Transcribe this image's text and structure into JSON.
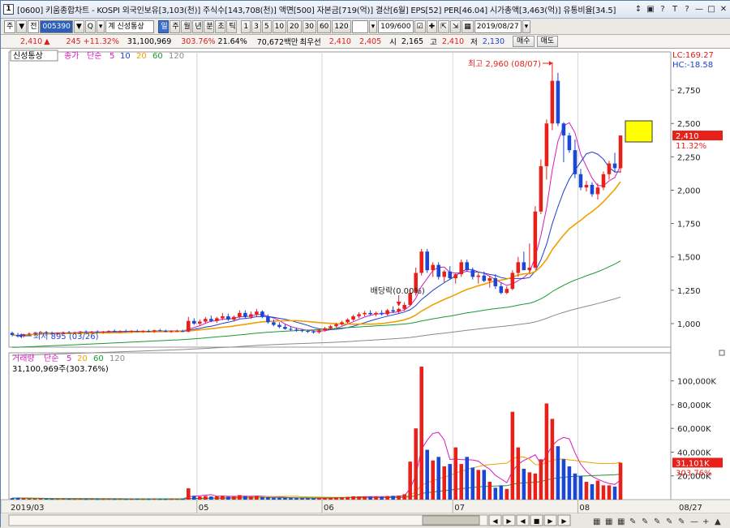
{
  "title": {
    "icon_label": "1",
    "text": "[0600] 키움종합차트 - KOSPI 외국인보유[3,103(천)] 주식수[143,708(천)] 액면[500] 자본금[719(억)] 결산[6월] EPS[52] PER[46.04] 시가총액[3,463(억)] 유통비율[34.5]",
    "buttons": [
      "↕",
      "▣",
      "?",
      "T",
      "?",
      "—",
      "□",
      "✕"
    ]
  },
  "toolbar": {
    "period_type": "주",
    "market": "전",
    "code": "005390",
    "name": "계 신성통상",
    "timeframes": [
      "일",
      "주",
      "월",
      "년",
      "분",
      "초",
      "틱"
    ],
    "timeframe_selected": "일",
    "minute_options": [
      "1",
      "3",
      "5",
      "10",
      "20",
      "30",
      "60",
      "120"
    ],
    "count": "109/600",
    "date": "2019/08/27"
  },
  "quote": {
    "price": "2,410",
    "arrow": "▲",
    "change": "245",
    "change_pct": "+11.32%",
    "volume": "31,100,969",
    "vol_ratio": "303.76%",
    "turnover": "21.64%",
    "amount": "70,672백만",
    "best_label": "최우선",
    "best_ask": "2,410",
    "best_bid": "2,405",
    "open_label": "시",
    "open": "2,165",
    "high_label": "고",
    "high": "2,410",
    "low_label": "저",
    "low": "2,130",
    "buy_label": "매수",
    "sell_label": "매도"
  },
  "colors": {
    "up": "#e8201a",
    "down": "#1a47d6",
    "ma5": "#d81bbd",
    "ma10": "#1a3fd0",
    "ma20": "#f0a000",
    "ma60": "#1a9a30",
    "ma120": "#8a8a8a",
    "lc": "#e01a1a",
    "hc": "#1a3fd0"
  },
  "price_panel": {
    "name": "신성통상",
    "legend": [
      {
        "label": "종가",
        "color_key": "ma5"
      },
      {
        "label": "단순",
        "color_key": "ma5"
      },
      {
        "label": "5",
        "color_key": "ma5"
      },
      {
        "label": "10",
        "color_key": "ma10"
      },
      {
        "label": "20",
        "color_key": "ma20"
      },
      {
        "label": "60",
        "color_key": "ma60"
      },
      {
        "label": "120",
        "color_key": "ma120"
      }
    ],
    "lc_text": "LC:169.27",
    "hc_text": "HC:-18.58",
    "high_note": "최고 2,960 (08/07)",
    "low_note": "최저 895 (03/26)",
    "div_note": "배당락(0.00%)",
    "last_price": "2,410",
    "last_pct": "11.32%"
  },
  "volume_panel": {
    "legend": [
      {
        "label": "거래량",
        "color_key": "ma5"
      },
      {
        "label": "단순",
        "color_key": "ma5"
      },
      {
        "label": "5",
        "color_key": "ma5"
      },
      {
        "label": "20",
        "color_key": "ma20"
      },
      {
        "label": "60",
        "color_key": "ma60"
      },
      {
        "label": "120",
        "color_key": "ma120"
      }
    ],
    "vol_text": "31,100,969주(303.76%)",
    "last_vol": "31,101K",
    "last_pct": "303.76%"
  },
  "x_axis_labels": [
    "2019/03",
    "05",
    "06",
    "07",
    "08",
    "08/27"
  ],
  "y_axis_price_ticks": [
    "2,750",
    "2,500",
    "2,250",
    "2,000",
    "1,750",
    "1,500",
    "1,250",
    "1,000"
  ],
  "y_axis_vol_ticks": [
    "100,000K",
    "80,000K",
    "60,000K",
    "40,000K",
    "20,000K"
  ],
  "chart_data": {
    "type": "candlestick",
    "price_range": [
      860,
      3000
    ],
    "volume_range": [
      0,
      110000
    ],
    "candles": [
      {
        "o": 930,
        "h": 940,
        "l": 905,
        "c": 915,
        "v": 1200
      },
      {
        "o": 915,
        "h": 930,
        "l": 895,
        "c": 905,
        "v": 1500
      },
      {
        "o": 905,
        "h": 925,
        "l": 895,
        "c": 920,
        "v": 1100
      },
      {
        "o": 920,
        "h": 935,
        "l": 910,
        "c": 925,
        "v": 900
      },
      {
        "o": 925,
        "h": 940,
        "l": 915,
        "c": 930,
        "v": 800
      },
      {
        "o": 930,
        "h": 945,
        "l": 920,
        "c": 935,
        "v": 900
      },
      {
        "o": 935,
        "h": 945,
        "l": 925,
        "c": 930,
        "v": 700
      },
      {
        "o": 930,
        "h": 940,
        "l": 920,
        "c": 925,
        "v": 600
      },
      {
        "o": 925,
        "h": 935,
        "l": 915,
        "c": 930,
        "v": 600
      },
      {
        "o": 930,
        "h": 940,
        "l": 920,
        "c": 935,
        "v": 700
      },
      {
        "o": 935,
        "h": 945,
        "l": 925,
        "c": 930,
        "v": 600
      },
      {
        "o": 930,
        "h": 940,
        "l": 920,
        "c": 935,
        "v": 500
      },
      {
        "o": 935,
        "h": 945,
        "l": 925,
        "c": 940,
        "v": 600
      },
      {
        "o": 940,
        "h": 950,
        "l": 930,
        "c": 935,
        "v": 500
      },
      {
        "o": 935,
        "h": 945,
        "l": 925,
        "c": 940,
        "v": 600
      },
      {
        "o": 940,
        "h": 950,
        "l": 930,
        "c": 935,
        "v": 500
      },
      {
        "o": 935,
        "h": 945,
        "l": 925,
        "c": 940,
        "v": 500
      },
      {
        "o": 940,
        "h": 950,
        "l": 930,
        "c": 945,
        "v": 600
      },
      {
        "o": 945,
        "h": 955,
        "l": 935,
        "c": 940,
        "v": 500
      },
      {
        "o": 940,
        "h": 950,
        "l": 930,
        "c": 945,
        "v": 600
      },
      {
        "o": 945,
        "h": 955,
        "l": 935,
        "c": 940,
        "v": 500
      },
      {
        "o": 940,
        "h": 950,
        "l": 930,
        "c": 945,
        "v": 500
      },
      {
        "o": 945,
        "h": 955,
        "l": 935,
        "c": 940,
        "v": 600
      },
      {
        "o": 940,
        "h": 950,
        "l": 930,
        "c": 945,
        "v": 500
      },
      {
        "o": 945,
        "h": 955,
        "l": 935,
        "c": 940,
        "v": 500
      },
      {
        "o": 940,
        "h": 955,
        "l": 930,
        "c": 950,
        "v": 600
      },
      {
        "o": 950,
        "h": 960,
        "l": 940,
        "c": 945,
        "v": 500
      },
      {
        "o": 945,
        "h": 955,
        "l": 935,
        "c": 940,
        "v": 500
      },
      {
        "o": 940,
        "h": 950,
        "l": 930,
        "c": 945,
        "v": 500
      },
      {
        "o": 945,
        "h": 955,
        "l": 935,
        "c": 945,
        "v": 600
      },
      {
        "o": 945,
        "h": 955,
        "l": 935,
        "c": 940,
        "v": 500
      },
      {
        "o": 940,
        "h": 1050,
        "l": 935,
        "c": 1020,
        "v": 9500
      },
      {
        "o": 1020,
        "h": 1040,
        "l": 990,
        "c": 1000,
        "v": 3200
      },
      {
        "o": 1000,
        "h": 1030,
        "l": 985,
        "c": 1015,
        "v": 2600
      },
      {
        "o": 1015,
        "h": 1050,
        "l": 1005,
        "c": 1035,
        "v": 3000
      },
      {
        "o": 1035,
        "h": 1060,
        "l": 1010,
        "c": 1020,
        "v": 2600
      },
      {
        "o": 1020,
        "h": 1050,
        "l": 1005,
        "c": 1040,
        "v": 2800
      },
      {
        "o": 1040,
        "h": 1080,
        "l": 1025,
        "c": 1055,
        "v": 3300
      },
      {
        "o": 1055,
        "h": 1075,
        "l": 1020,
        "c": 1030,
        "v": 2400
      },
      {
        "o": 1030,
        "h": 1060,
        "l": 1015,
        "c": 1050,
        "v": 2500
      },
      {
        "o": 1050,
        "h": 1100,
        "l": 1040,
        "c": 1080,
        "v": 3800
      },
      {
        "o": 1080,
        "h": 1100,
        "l": 1040,
        "c": 1050,
        "v": 2800
      },
      {
        "o": 1050,
        "h": 1090,
        "l": 1035,
        "c": 1070,
        "v": 2600
      },
      {
        "o": 1070,
        "h": 1110,
        "l": 1050,
        "c": 1090,
        "v": 3200
      },
      {
        "o": 1090,
        "h": 1100,
        "l": 1040,
        "c": 1050,
        "v": 2200
      },
      {
        "o": 1050,
        "h": 1070,
        "l": 1000,
        "c": 1010,
        "v": 2100
      },
      {
        "o": 1010,
        "h": 1030,
        "l": 980,
        "c": 990,
        "v": 1800
      },
      {
        "o": 990,
        "h": 1010,
        "l": 965,
        "c": 975,
        "v": 1600
      },
      {
        "o": 975,
        "h": 995,
        "l": 955,
        "c": 960,
        "v": 1400
      },
      {
        "o": 960,
        "h": 980,
        "l": 945,
        "c": 955,
        "v": 1300
      },
      {
        "o": 955,
        "h": 970,
        "l": 940,
        "c": 950,
        "v": 1200
      },
      {
        "o": 950,
        "h": 960,
        "l": 935,
        "c": 945,
        "v": 1100
      },
      {
        "o": 945,
        "h": 955,
        "l": 930,
        "c": 940,
        "v": 1000
      },
      {
        "o": 940,
        "h": 950,
        "l": 925,
        "c": 935,
        "v": 1000
      },
      {
        "o": 935,
        "h": 960,
        "l": 925,
        "c": 950,
        "v": 1200
      },
      {
        "o": 950,
        "h": 975,
        "l": 940,
        "c": 965,
        "v": 1400
      },
      {
        "o": 965,
        "h": 990,
        "l": 955,
        "c": 980,
        "v": 1600
      },
      {
        "o": 980,
        "h": 1005,
        "l": 970,
        "c": 995,
        "v": 1800
      },
      {
        "o": 995,
        "h": 1020,
        "l": 985,
        "c": 1010,
        "v": 2000
      },
      {
        "o": 1010,
        "h": 1040,
        "l": 1000,
        "c": 1030,
        "v": 2300
      },
      {
        "o": 1030,
        "h": 1065,
        "l": 1020,
        "c": 1055,
        "v": 2800
      },
      {
        "o": 1055,
        "h": 1085,
        "l": 1040,
        "c": 1070,
        "v": 2700
      },
      {
        "o": 1070,
        "h": 1095,
        "l": 1055,
        "c": 1080,
        "v": 2600
      },
      {
        "o": 1080,
        "h": 1100,
        "l": 1060,
        "c": 1070,
        "v": 2400
      },
      {
        "o": 1070,
        "h": 1090,
        "l": 1055,
        "c": 1080,
        "v": 2500
      },
      {
        "o": 1080,
        "h": 1100,
        "l": 1060,
        "c": 1070,
        "v": 2300
      },
      {
        "o": 1070,
        "h": 1110,
        "l": 1060,
        "c": 1100,
        "v": 3000
      },
      {
        "o": 1100,
        "h": 1130,
        "l": 1080,
        "c": 1090,
        "v": 3200
      },
      {
        "o": 1090,
        "h": 1120,
        "l": 1075,
        "c": 1110,
        "v": 3400
      },
      {
        "o": 1110,
        "h": 1160,
        "l": 1095,
        "c": 1140,
        "v": 4500
      },
      {
        "o": 1140,
        "h": 1260,
        "l": 1130,
        "c": 1230,
        "v": 32000
      },
      {
        "o": 1230,
        "h": 1420,
        "l": 1210,
        "c": 1380,
        "v": 60000
      },
      {
        "o": 1380,
        "h": 1560,
        "l": 1360,
        "c": 1540,
        "v": 112000
      },
      {
        "o": 1540,
        "h": 1560,
        "l": 1380,
        "c": 1400,
        "v": 42000
      },
      {
        "o": 1400,
        "h": 1460,
        "l": 1350,
        "c": 1440,
        "v": 33000
      },
      {
        "o": 1440,
        "h": 1460,
        "l": 1330,
        "c": 1350,
        "v": 36000
      },
      {
        "o": 1350,
        "h": 1400,
        "l": 1310,
        "c": 1390,
        "v": 28000
      },
      {
        "o": 1390,
        "h": 1430,
        "l": 1330,
        "c": 1340,
        "v": 30000
      },
      {
        "o": 1340,
        "h": 1380,
        "l": 1300,
        "c": 1370,
        "v": 44000
      },
      {
        "o": 1370,
        "h": 1480,
        "l": 1350,
        "c": 1460,
        "v": 30000
      },
      {
        "o": 1460,
        "h": 1480,
        "l": 1390,
        "c": 1400,
        "v": 36000
      },
      {
        "o": 1400,
        "h": 1420,
        "l": 1330,
        "c": 1350,
        "v": 27000
      },
      {
        "o": 1350,
        "h": 1380,
        "l": 1300,
        "c": 1360,
        "v": 25000
      },
      {
        "o": 1360,
        "h": 1390,
        "l": 1310,
        "c": 1320,
        "v": 25000
      },
      {
        "o": 1320,
        "h": 1360,
        "l": 1270,
        "c": 1340,
        "v": 15000
      },
      {
        "o": 1340,
        "h": 1370,
        "l": 1260,
        "c": 1280,
        "v": 10000
      },
      {
        "o": 1280,
        "h": 1310,
        "l": 1220,
        "c": 1230,
        "v": 12000
      },
      {
        "o": 1230,
        "h": 1280,
        "l": 1220,
        "c": 1260,
        "v": 9000
      },
      {
        "o": 1260,
        "h": 1400,
        "l": 1250,
        "c": 1380,
        "v": 74000
      },
      {
        "o": 1380,
        "h": 1500,
        "l": 1350,
        "c": 1460,
        "v": 44000
      },
      {
        "o": 1460,
        "h": 1540,
        "l": 1420,
        "c": 1400,
        "v": 26000
      },
      {
        "o": 1400,
        "h": 1600,
        "l": 1380,
        "c": 1420,
        "v": 23000
      },
      {
        "o": 1420,
        "h": 1880,
        "l": 1410,
        "c": 1840,
        "v": 22000
      },
      {
        "o": 1840,
        "h": 2230,
        "l": 1820,
        "c": 2180,
        "v": 34000
      },
      {
        "o": 2180,
        "h": 2530,
        "l": 2080,
        "c": 2500,
        "v": 81000
      },
      {
        "o": 2500,
        "h": 2960,
        "l": 2450,
        "c": 2820,
        "v": 68000
      },
      {
        "o": 2820,
        "h": 2880,
        "l": 2480,
        "c": 2500,
        "v": 45000
      },
      {
        "o": 2500,
        "h": 2510,
        "l": 2210,
        "c": 2410,
        "v": 34000
      },
      {
        "o": 2410,
        "h": 2430,
        "l": 2280,
        "c": 2300,
        "v": 28000
      },
      {
        "o": 2300,
        "h": 2380,
        "l": 2090,
        "c": 2120,
        "v": 22000
      },
      {
        "o": 2120,
        "h": 2160,
        "l": 2000,
        "c": 2020,
        "v": 20000
      },
      {
        "o": 2020,
        "h": 2070,
        "l": 1990,
        "c": 2040,
        "v": 15000
      },
      {
        "o": 2040,
        "h": 2060,
        "l": 1950,
        "c": 1970,
        "v": 13000
      },
      {
        "o": 1970,
        "h": 2050,
        "l": 1930,
        "c": 2020,
        "v": 16000
      },
      {
        "o": 2020,
        "h": 2140,
        "l": 2000,
        "c": 2120,
        "v": 12000
      },
      {
        "o": 2120,
        "h": 2220,
        "l": 2080,
        "c": 2200,
        "v": 12000
      },
      {
        "o": 2200,
        "h": 2280,
        "l": 2130,
        "c": 2165,
        "v": 11000
      },
      {
        "o": 2165,
        "h": 2410,
        "l": 2130,
        "c": 2410,
        "v": 31101
      }
    ]
  },
  "bottom_controls": [
    "◀",
    "▶",
    "◀",
    "■",
    "▶",
    "▶"
  ]
}
